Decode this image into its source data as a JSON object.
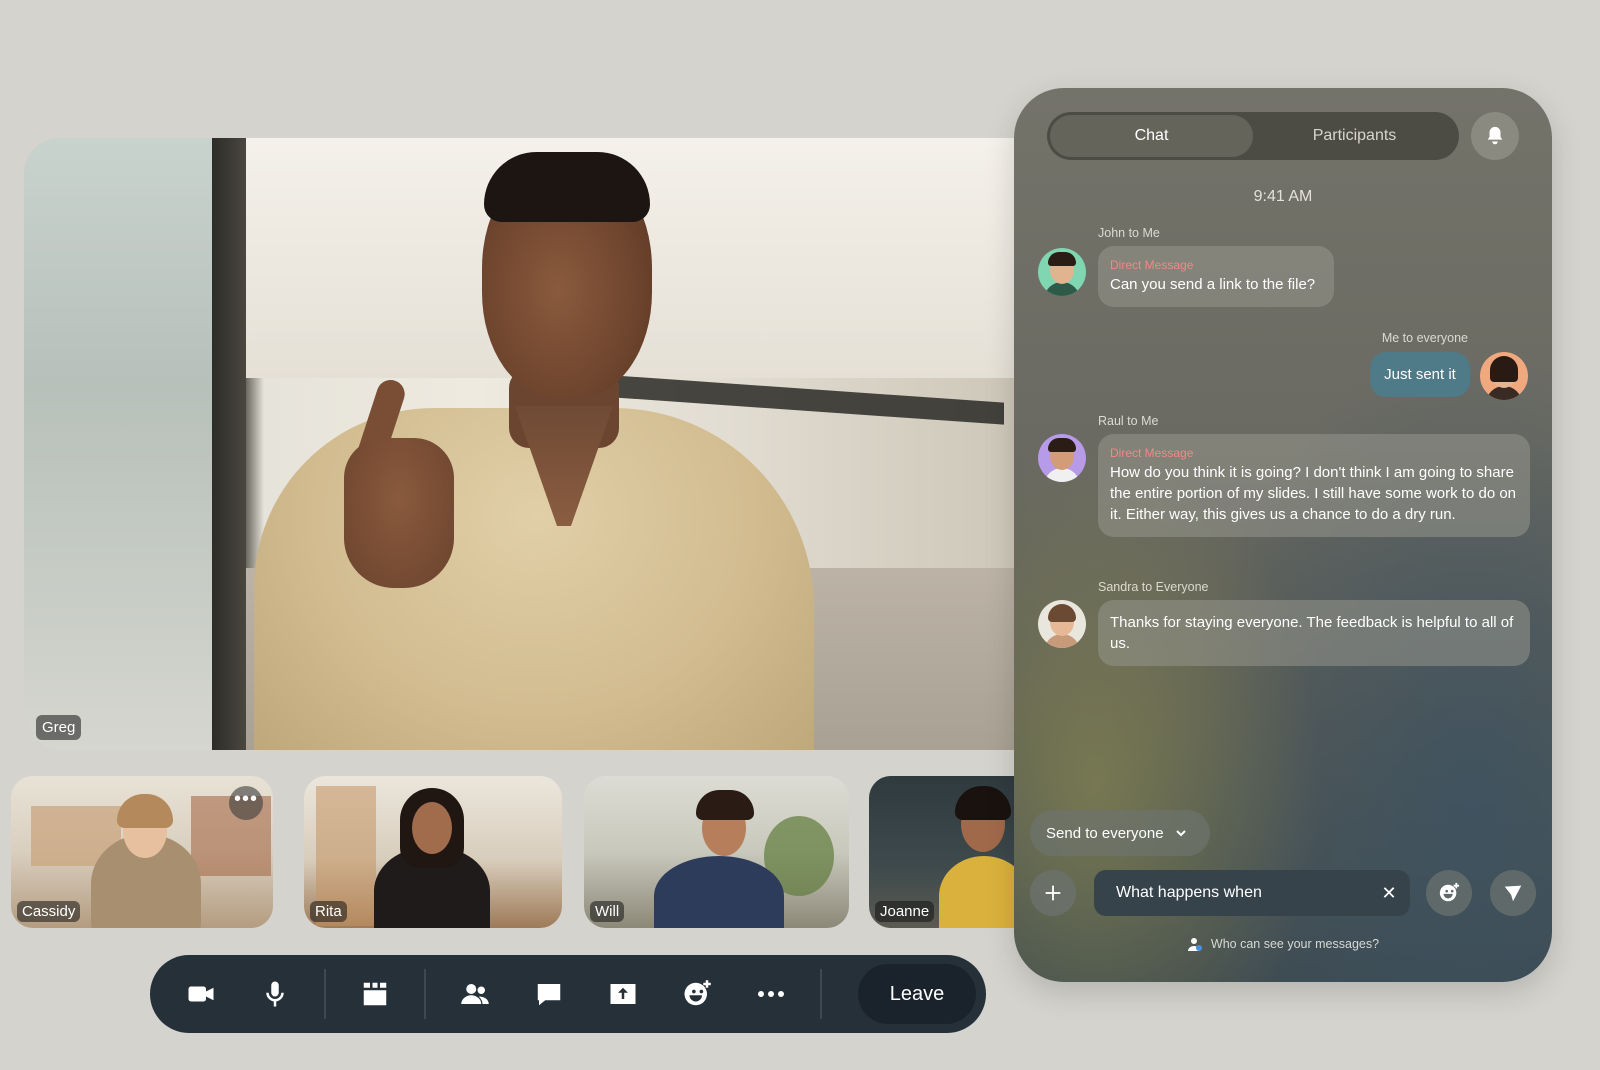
{
  "main_video": {
    "participant": "Greg"
  },
  "thumbnails": [
    {
      "name": "Cassidy",
      "more": "•••"
    },
    {
      "name": "Rita"
    },
    {
      "name": "Will"
    },
    {
      "name": "Joanne"
    }
  ],
  "controls": {
    "icons": [
      "video-camera-icon",
      "microphone-icon",
      "grid-view-icon",
      "participants-icon",
      "chat-icon",
      "share-screen-icon",
      "reactions-icon",
      "more-icon"
    ],
    "leave_label": "Leave"
  },
  "chat": {
    "tabs": [
      {
        "label": "Chat",
        "active": true
      },
      {
        "label": "Participants",
        "active": false
      }
    ],
    "time": "9:41 AM",
    "messages": [
      {
        "sender": "John to Me",
        "tag": "Direct Message",
        "text": "Can you send a link to the file?"
      },
      {
        "sender": "Me to everyone",
        "text": "Just sent it"
      },
      {
        "sender": "Raul to Me",
        "tag": "Direct Message",
        "text": "How do you think it is going? I don't think I am going to share the entire portion of my slides. I still have some work to do on it. Either way, this gives us a chance to do a dry run."
      },
      {
        "sender": "Sandra to Everyone",
        "text": "Thanks for staying everyone. The feedback is helpful to all of us."
      }
    ],
    "send_to": "Send to everyone",
    "input_value": "What happens when",
    "clear": "✕",
    "privacy_text": "Who can see your messages?"
  },
  "colors": {
    "background": "#d4d3ce",
    "control_bar": "#253039",
    "direct_message": "#f08a86",
    "my_bubble": "#4f7a88"
  }
}
